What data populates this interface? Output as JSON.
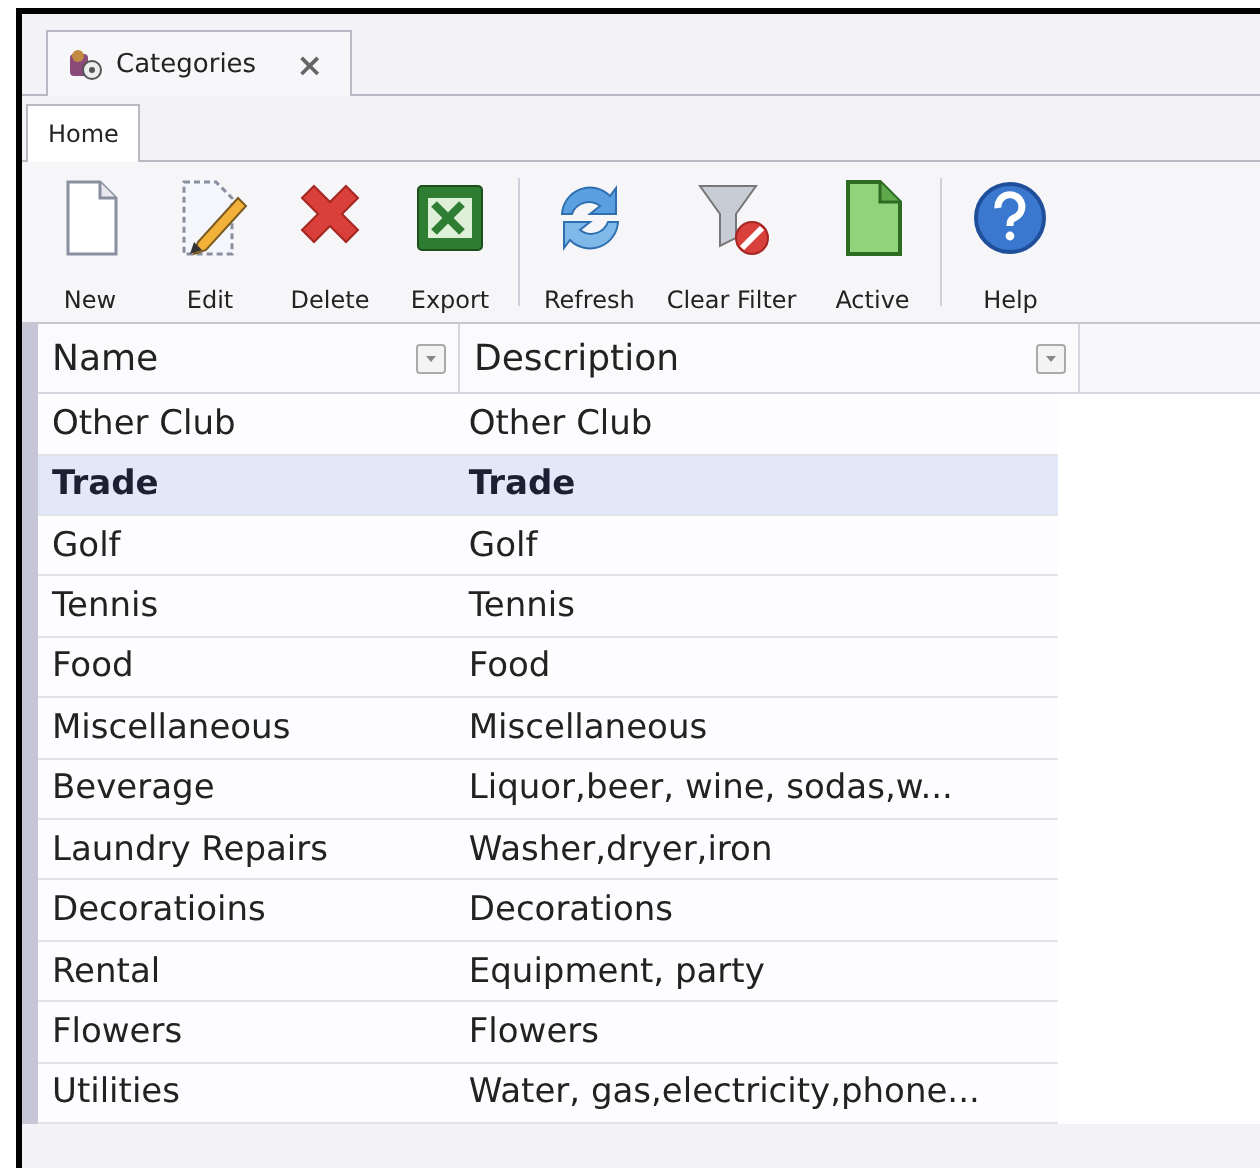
{
  "document_tab": {
    "title": "Categories",
    "close": "×"
  },
  "ribbon_tabs": [
    {
      "label": "Home",
      "selected": true
    }
  ],
  "toolbar_groups": [
    [
      {
        "label": "New",
        "kind": "new"
      },
      {
        "label": "Edit",
        "kind": "edit"
      },
      {
        "label": "Delete",
        "kind": "delete"
      },
      {
        "label": "Export",
        "kind": "export"
      }
    ],
    [
      {
        "label": "Refresh",
        "kind": "refresh"
      },
      {
        "label": "Clear Filter",
        "kind": "clearfilter"
      },
      {
        "label": "Active",
        "kind": "active"
      }
    ],
    [
      {
        "label": "Help",
        "kind": "help"
      }
    ]
  ],
  "table": {
    "columns": [
      "Name",
      "Description"
    ],
    "rows": [
      {
        "name": "Other Club",
        "description": "Other Club",
        "selected": false
      },
      {
        "name": "Trade",
        "description": "Trade",
        "selected": true
      },
      {
        "name": "Golf",
        "description": "Golf",
        "selected": false
      },
      {
        "name": "Tennis",
        "description": "Tennis",
        "selected": false
      },
      {
        "name": "Food",
        "description": "Food",
        "selected": false
      },
      {
        "name": "Miscellaneous",
        "description": "Miscellaneous",
        "selected": false
      },
      {
        "name": "Beverage",
        "description": "Liquor,beer, wine, sodas,w...",
        "selected": false
      },
      {
        "name": "Laundry Repairs",
        "description": "Washer,dryer,iron",
        "selected": false
      },
      {
        "name": "Decoratioins",
        "description": "Decorations",
        "selected": false
      },
      {
        "name": "Rental",
        "description": "Equipment, party",
        "selected": false
      },
      {
        "name": "Flowers",
        "description": "Flowers",
        "selected": false
      },
      {
        "name": "Utilities",
        "description": "Water, gas,electricity,phone...",
        "selected": false
      }
    ]
  }
}
